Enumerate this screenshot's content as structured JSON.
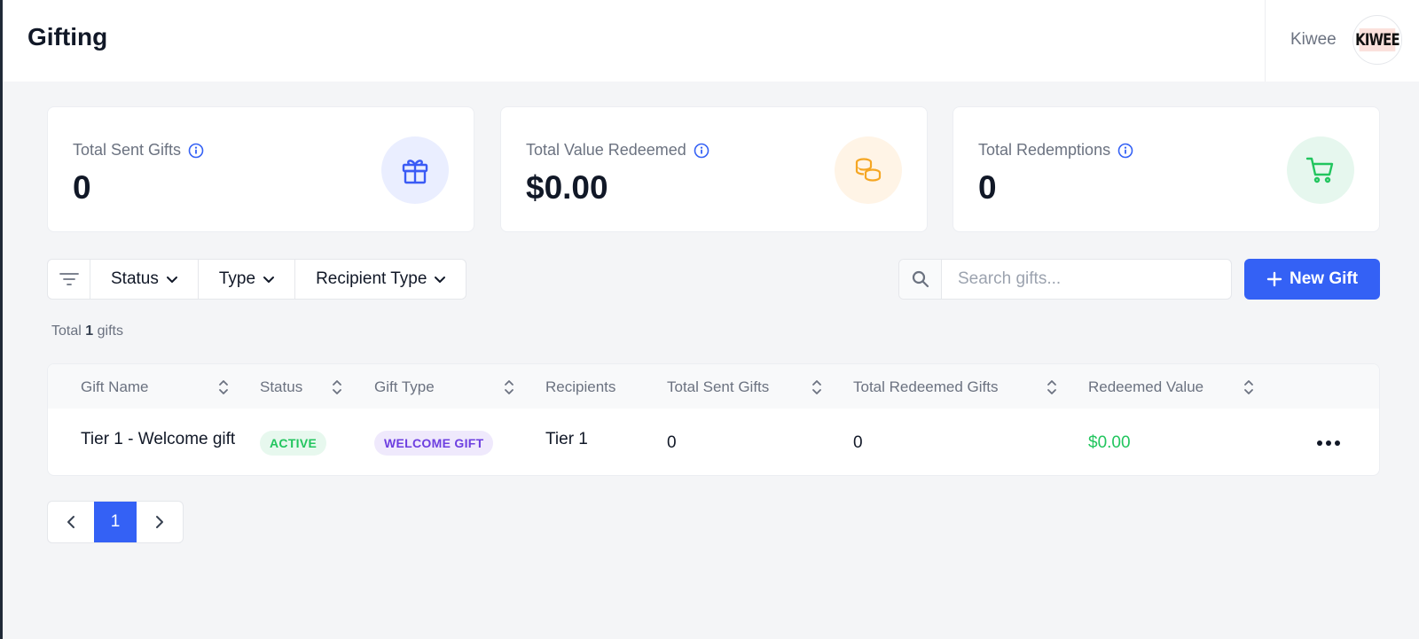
{
  "header": {
    "title": "Gifting",
    "user_name": "Kiwee",
    "avatar_text": "KIWEE"
  },
  "stats": [
    {
      "label": "Total Sent Gifts",
      "value": "0",
      "icon": "gift-icon",
      "color": "#3b5bf5",
      "bg": "#eaeeff"
    },
    {
      "label": "Total Value Redeemed",
      "value": "$0.00",
      "icon": "coins-icon",
      "color": "#f5a623",
      "bg": "#fff4e6"
    },
    {
      "label": "Total Redemptions",
      "value": "0",
      "icon": "cart-icon",
      "color": "#22c55e",
      "bg": "#e6f7ee"
    }
  ],
  "filters": {
    "items": [
      {
        "label": "Status"
      },
      {
        "label": "Type"
      },
      {
        "label": "Recipient Type"
      }
    ]
  },
  "search": {
    "placeholder": "Search gifts...",
    "value": ""
  },
  "actions": {
    "new_gift_label": "New Gift"
  },
  "summary": {
    "prefix": "Total",
    "count": "1",
    "suffix": "gifts"
  },
  "table": {
    "columns": [
      "Gift Name",
      "Status",
      "Gift Type",
      "Recipients",
      "Total Sent Gifts",
      "Total Redeemed Gifts",
      "Redeemed Value"
    ],
    "rows": [
      {
        "name": "Tier 1 - Welcome gift",
        "status": "ACTIVE",
        "gift_type": "WELCOME GIFT",
        "recipients": "Tier 1",
        "total_sent": "0",
        "total_redeemed": "0",
        "redeemed_value": "$0.00"
      }
    ]
  },
  "pagination": {
    "current_page": "1"
  },
  "colors": {
    "accent": "#3461f5",
    "active_text": "#22c55e",
    "active_bg": "#e7f8ee",
    "welcome_text": "#6d3fe0",
    "welcome_bg": "#efe9fc",
    "money_text": "#22c55e"
  }
}
